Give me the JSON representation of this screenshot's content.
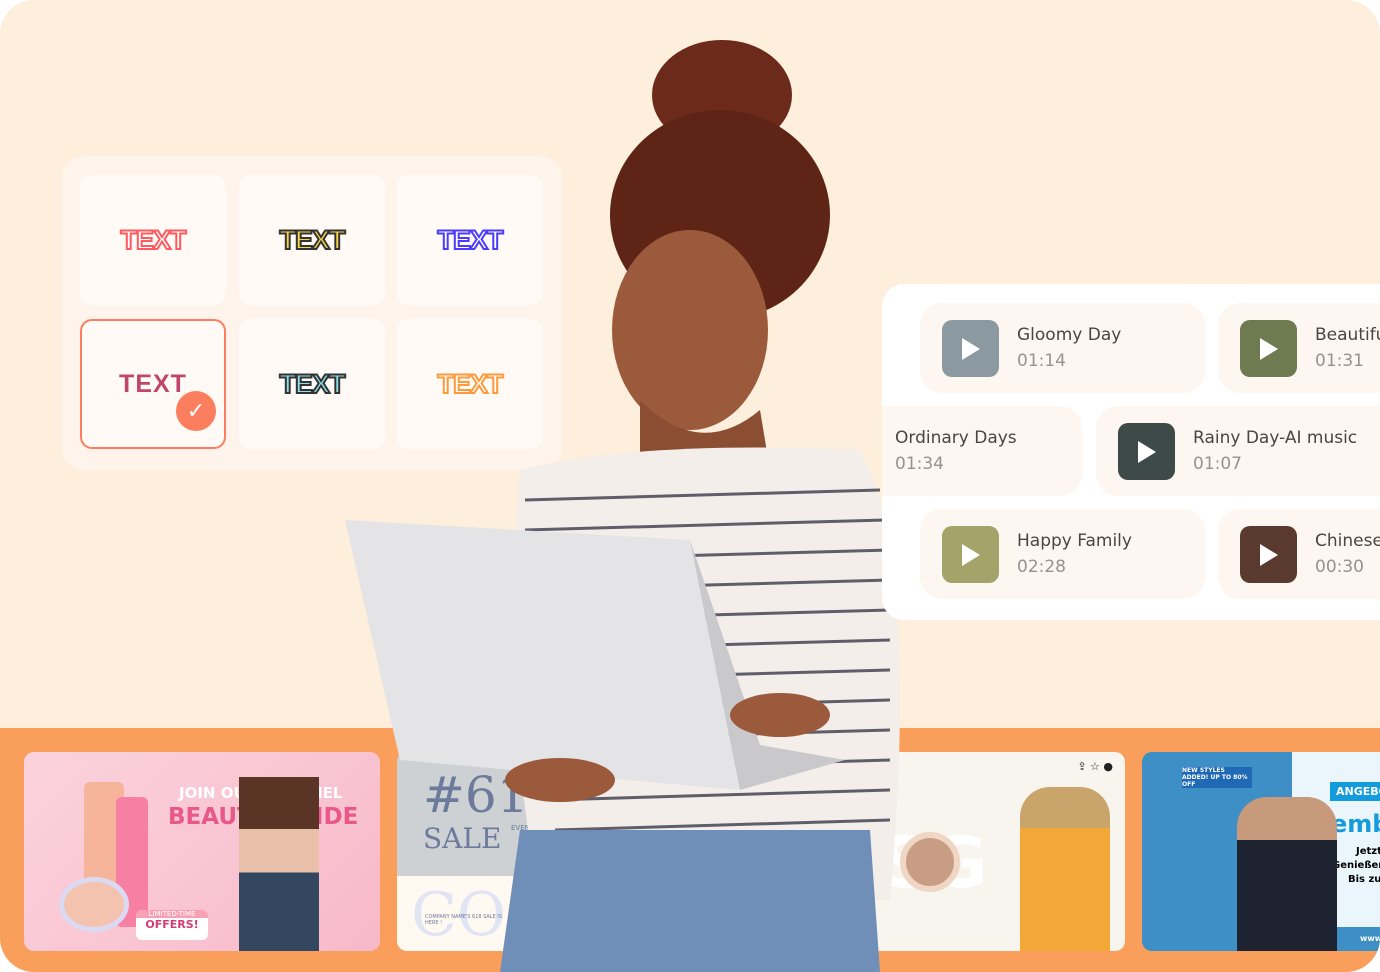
{
  "text_presets": {
    "items": [
      {
        "label": "TEXT",
        "fill": "#FFFFFF",
        "stroke": "#FF5A5F"
      },
      {
        "label": "TEXT",
        "fill": "#F7D54A",
        "stroke": "#333333"
      },
      {
        "label": "TEXT",
        "fill": "#FFFFFF",
        "stroke": "#4B3BFF"
      },
      {
        "label": "TEXT",
        "fill": "#C0466E",
        "stroke": "none",
        "selected": true
      },
      {
        "label": "TEXT",
        "fill": "#8BE0EA",
        "stroke": "#333333"
      },
      {
        "label": "TEXT",
        "fill": "#FFFFFF",
        "stroke": "#FF9A3C"
      }
    ],
    "accent": "#FB7E5E"
  },
  "music": {
    "items": [
      {
        "title": "Gloomy Day",
        "duration": "01:14",
        "thumb": "#8a9aa0"
      },
      {
        "title": "Beautifu",
        "duration": "01:31",
        "thumb": "#6e7a4f"
      },
      {
        "title": "Ordinary Days",
        "duration": "01:34"
      },
      {
        "title": "Rainy Day-AI music",
        "duration": "01:07",
        "thumb": "#3d4a47"
      },
      {
        "title": "Happy Family",
        "duration": "02:28",
        "thumb": "#a4a36a"
      },
      {
        "title": "Chinese",
        "duration": "00:30",
        "thumb": "#5a3a2e"
      }
    ]
  },
  "templates": {
    "beauty": {
      "line1": "JOIN OUR CHANNEL",
      "line2": "BEAUTY GUIDE",
      "badge_top": "LIMITED-TIME",
      "badge_bottom": "OFFERS!"
    },
    "sale": {
      "number": "#618",
      "word": "SALE",
      "big": "CO",
      "small": "COMPANY NAME'S 618 SALE IS HERE !",
      "event": "EVENT"
    },
    "skincare": {
      "watermark": "SG"
    },
    "member": {
      "tag": "ANGEBOT",
      "word": "memb",
      "l1": "Jetzt",
      "l2": "Genießen",
      "l3": "Bis zu",
      "url": "www",
      "banner": "NEW STYLES ADDED! UP TO 80% OFF"
    }
  }
}
